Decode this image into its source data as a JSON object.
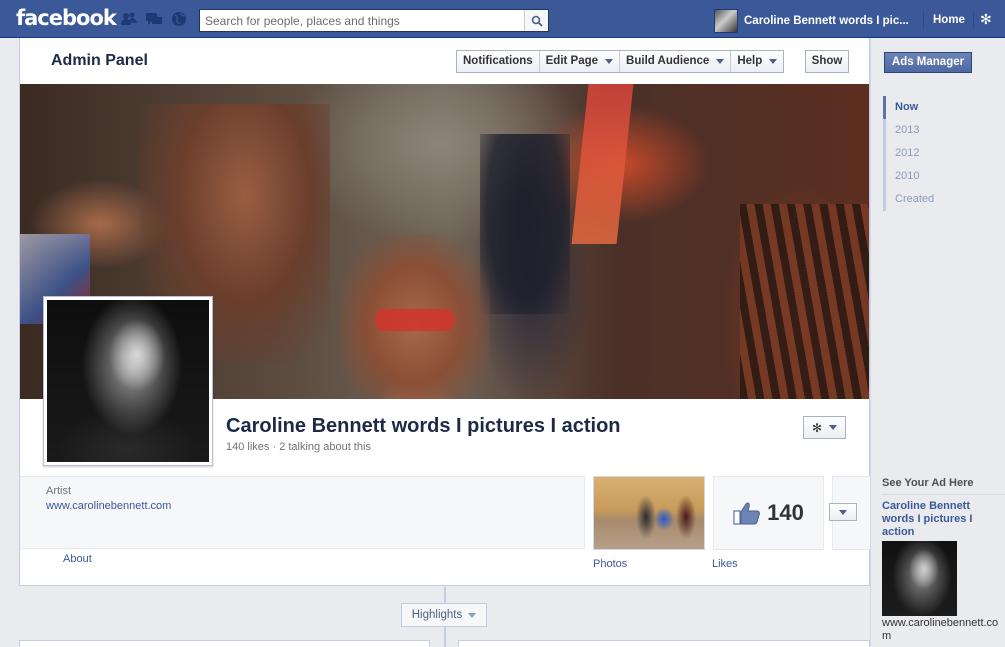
{
  "topbar": {
    "logo": "facebook",
    "search_placeholder": "Search for people, places and things",
    "user_name": "Caroline Bennett words I pic...",
    "home_label": "Home"
  },
  "admin": {
    "title": "Admin Panel",
    "buttons": [
      {
        "label": "Notifications"
      },
      {
        "label": "Edit Page"
      },
      {
        "label": "Build Audience"
      },
      {
        "label": "Help"
      }
    ],
    "show_label": "Show"
  },
  "page": {
    "name": "Caroline Bennett words I pictures I action",
    "stats": "140 likes · 2 talking about this",
    "category": "Artist",
    "website": "www.carolinebennett.com"
  },
  "apps": {
    "photos_label": "Photos",
    "likes_count": "140",
    "likes_label": "Likes",
    "about_label": "About"
  },
  "timeline": {
    "highlights_label": "Highlights"
  },
  "right": {
    "ads_manager_label": "Ads Manager",
    "years": [
      {
        "label": "Now",
        "active": true
      },
      {
        "label": "2013",
        "active": false
      },
      {
        "label": "2012",
        "active": false
      },
      {
        "label": "2010",
        "active": false
      },
      {
        "label": "Created",
        "active": false
      }
    ],
    "see_ad_label": "See Your Ad Here",
    "ad_title": "Caroline Bennett words I pictures I action",
    "ad_url": "www.carolinebennett.com"
  },
  "colors": {
    "brand_blue": "#3b5998",
    "link_blue": "#3b5998"
  }
}
